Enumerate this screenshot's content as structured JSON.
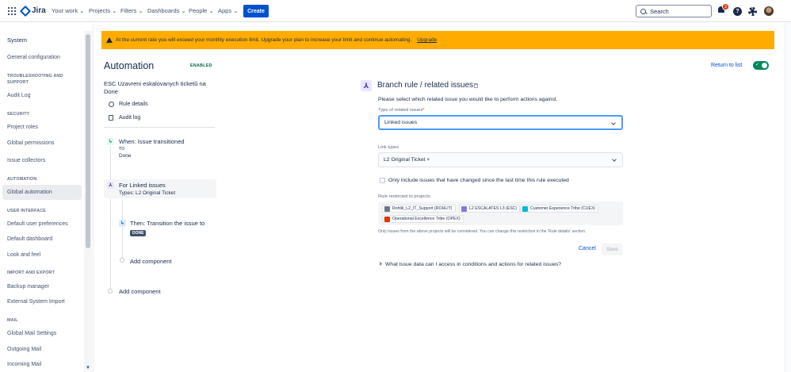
{
  "topnav": {
    "logo": "Jira",
    "menus": [
      "Your work",
      "Projects",
      "Filters",
      "Dashboards",
      "People",
      "Apps"
    ],
    "create_label": "Create",
    "search_placeholder": "Search",
    "notification_count": "3",
    "help_glyph": "?"
  },
  "sidebar": {
    "title": "System",
    "sections": [
      {
        "heading": "",
        "items": [
          "General configuration"
        ]
      },
      {
        "heading": "TROUBLESHOOTING AND SUPPORT",
        "items": [
          "Audit Log"
        ]
      },
      {
        "heading": "SECURITY",
        "items": [
          "Project roles",
          "Global permissions",
          "Issue collectors"
        ]
      },
      {
        "heading": "AUTOMATION",
        "items": [
          "Global automation"
        ]
      },
      {
        "heading": "USER INTERFACE",
        "items": [
          "Default user preferences",
          "Default dashboard",
          "Look and feel"
        ]
      },
      {
        "heading": "IMPORT AND EXPORT",
        "items": [
          "Backup manager",
          "External System Import"
        ]
      },
      {
        "heading": "MAIL",
        "items": [
          "Global Mail Settings",
          "Outgoing Mail",
          "Incoming Mail"
        ]
      }
    ],
    "active_item": "Global automation"
  },
  "banner": {
    "message": "At the current rate you will exceed your monthly execution limit. Upgrade your plan to increase your limit and continue automating.",
    "link": "Upgrade"
  },
  "header": {
    "title": "Automation",
    "status": "ENABLED",
    "return_link": "Return to list"
  },
  "rule": {
    "name": "ESC Uzavreni eskalovanych ticketů na Done",
    "details_label": "Rule details",
    "audit_label": "Audit log",
    "trigger": {
      "title": "When: Issue transitioned",
      "to_label": "TO",
      "to_value": "Done"
    },
    "branch": {
      "title": "For Linked issues",
      "subtitle": "Types: L2 Original Ticket"
    },
    "action": {
      "title": "Then: Transition the issue to",
      "lozenge": "DONE"
    },
    "add_component_inner": "Add component",
    "add_component_outer": "Add component"
  },
  "panel": {
    "title": "Branch rule / related issues",
    "description": "Please select which related issue you would like to perform actions against.",
    "type_label": "Type of related issues",
    "required_mark": "*",
    "type_value": "Linked issues",
    "link_types_label": "Link types",
    "link_types_value": "L2 Original Ticket ×",
    "checkbox_label": "Only include issues that have changed since the last time this rule executed",
    "restricted_label": "Rule restricted to projects",
    "projects": [
      {
        "name": "Rohlik_L2_IT_Support (ROHLIT)",
        "color": "#6b778c"
      },
      {
        "name": "L2 ESCALATES L3 (ESC)",
        "color": "#8777d9"
      },
      {
        "name": "Customer Experience Tribe (CUEX)",
        "color": "#00b8d9"
      },
      {
        "name": "Operational Excellence Tribe (OPEX)",
        "color": "#de350b"
      }
    ],
    "help_text": "Only issues from the above projects will be considered. You can change this restriction in the 'Rule details' section.",
    "cancel_label": "Cancel",
    "save_label": "Save",
    "expander_label": "What issue data can I access in conditions and actions for related issues?"
  },
  "colors": {
    "accent": "#0052cc",
    "banner": "#ffab00",
    "enabled": "#00875a"
  }
}
